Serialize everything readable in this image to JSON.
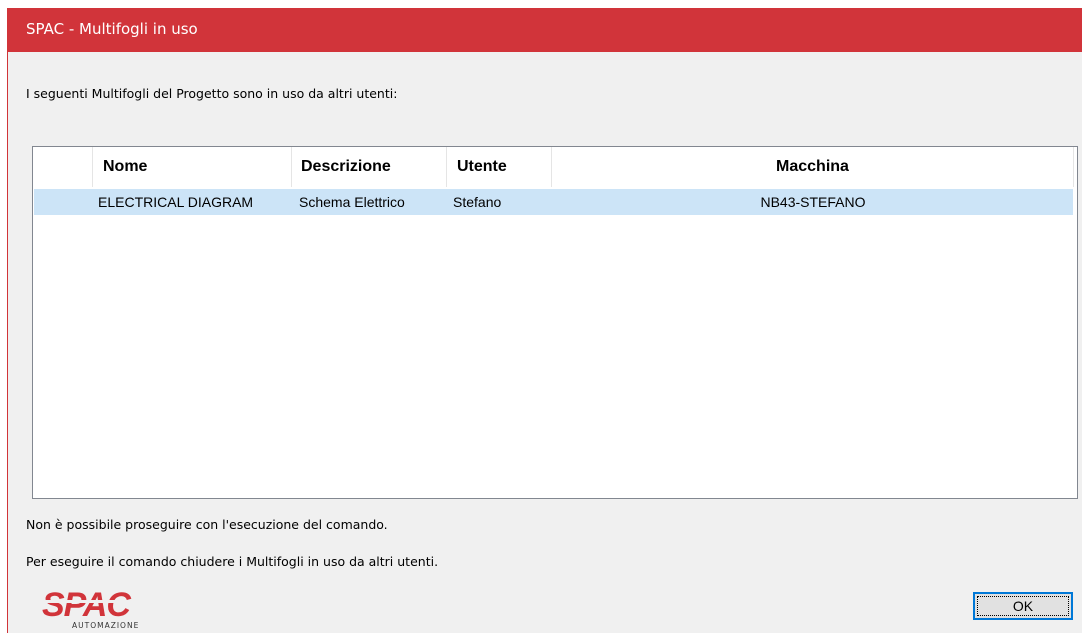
{
  "window": {
    "title": "SPAC - Multifogli in uso"
  },
  "message": "I seguenti Multifogli del Progetto sono in uso da altri utenti:",
  "table": {
    "columns": [
      "Nome",
      "Descrizione",
      "Utente",
      "Macchina"
    ],
    "rows": [
      {
        "nome": "ELECTRICAL DIAGRAM",
        "descrizione": "Schema Elettrico",
        "utente": "Stefano",
        "macchina": "NB43-STEFANO",
        "selected": true
      }
    ]
  },
  "status": {
    "line1": "Non è possibile proseguire con l'esecuzione del comando.",
    "line2": "Per eseguire il comando chiudere i Multifogli in uso da altri utenti."
  },
  "logo": {
    "brand": "SPAC",
    "tagline": "AUTOMAZIONE"
  },
  "buttons": {
    "ok_label": "OK"
  },
  "colors": {
    "titlebar": "#d1343a",
    "selection": "#cce4f7",
    "brand_red": "#d1343a",
    "focus_blue": "#0078d7"
  }
}
